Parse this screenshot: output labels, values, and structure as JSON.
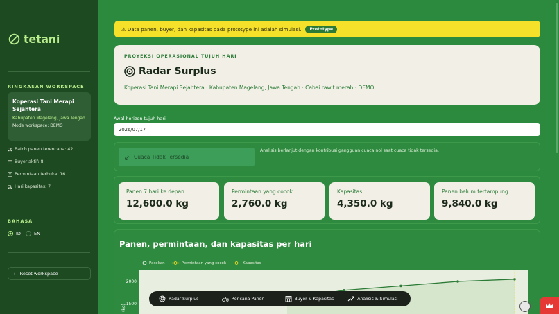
{
  "app": {
    "name": "tetani"
  },
  "sidebar": {
    "workspace_heading": "RINGKASAN WORKSPACE",
    "workspace": {
      "name": "Koperasi Tani Merapi Sejahtera",
      "location": "Kabupaten Magelang, Jawa Tengah",
      "mode": "Mode workspace: DEMO"
    },
    "stats": [
      {
        "icon": "truck-icon",
        "label": "Batch panen terencana: 42"
      },
      {
        "icon": "box-icon",
        "label": "Buyer aktif: 8"
      },
      {
        "icon": "list-icon",
        "label": "Permintaan terbuka: 16"
      },
      {
        "icon": "truck-icon",
        "label": "Hari kapasitas: 7"
      }
    ],
    "language_heading": "BAHASA",
    "languages": [
      {
        "label": "ID",
        "selected": true
      },
      {
        "label": "EN",
        "selected": false
      }
    ],
    "reset_label": "Reset workspace"
  },
  "banner": {
    "text": "⚠ Data panen, buyer, dan kapasitas pada prototype ini adalah simulasi.",
    "badge": "Prototype"
  },
  "hero": {
    "eyebrow": "PROYEKSI OPERASIONAL TUJUH HARI",
    "title": "Radar Surplus",
    "subtitle": "Koperasi Tani Merapi Sejahtera · Kabupaten Magelang, Jawa Tengah · Cabai rawit merah · DEMO"
  },
  "horizon": {
    "label": "Awal horizon tujuh hari",
    "value": "2026/07/17"
  },
  "weather": {
    "button_label": "Cuaca Tidak Tersedia",
    "note": "Analisis berlanjut dengan kontribusi gangguan cuaca nol saat cuaca tidak tersedia."
  },
  "metrics": [
    {
      "label": "Panen 7 hari ke depan",
      "value": "12,600.0 kg"
    },
    {
      "label": "Permintaan yang cocok",
      "value": "2,760.0 kg"
    },
    {
      "label": "Kapasitas",
      "value": "4,350.0 kg"
    },
    {
      "label": "Panen belum tertampung",
      "value": "9,840.0 kg"
    }
  ],
  "chart_section_title": "Panen, permintaan, dan kapasitas per hari",
  "chart_data": {
    "type": "line",
    "title": "",
    "legend": [
      "Pasokan",
      "Permintaan yang cocok",
      "Kapasitas"
    ],
    "ylabel": "kg",
    "y_ticks": [
      "2000",
      "1500"
    ],
    "series": [
      {
        "name": "Pasokan",
        "values": [
          null,
          null,
          1600,
          1800,
          1900,
          2000,
          2050
        ],
        "color": "#2b7a36"
      }
    ],
    "colors": {
      "supply": "#2b7a36",
      "demand": "#f5e02a",
      "capacity": "#f5e02a"
    }
  },
  "bottom_nav": [
    {
      "icon": "radar-icon",
      "label": "Radar Surplus"
    },
    {
      "icon": "tractor-icon",
      "label": "Rencana Panen"
    },
    {
      "icon": "store-icon",
      "label": "Buyer & Kapasitas"
    },
    {
      "icon": "trend-icon",
      "label": "Analisis & Simulasi"
    }
  ]
}
